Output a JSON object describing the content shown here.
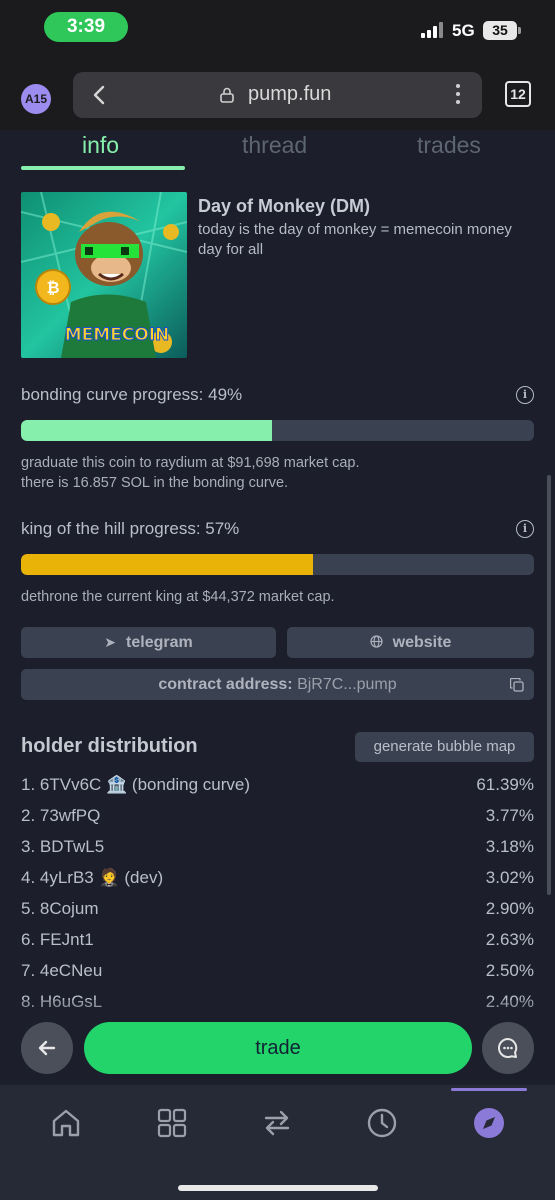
{
  "status_bar": {
    "time": "3:39",
    "network": "5G",
    "battery": "35"
  },
  "browser": {
    "profile": "A15",
    "url": "pump.fun",
    "tab_count": "12"
  },
  "tabs": [
    {
      "label": "info",
      "active": true
    },
    {
      "label": "thread",
      "active": false
    },
    {
      "label": "trades",
      "active": false
    }
  ],
  "coin": {
    "name": "Day of Monkey (DM)",
    "description": "today is the day of monkey = memecoin money day for all",
    "image_text": "MEMECOIN"
  },
  "bonding_curve": {
    "label": "bonding curve progress: 49%",
    "progress": 0.49,
    "note_line1": "graduate this coin to raydium at $91,698 market cap.",
    "note_line2": "there is 16.857 SOL in the bonding curve.",
    "color": "#86efac"
  },
  "king_of_hill": {
    "label": "king of the hill progress: 57%",
    "progress": 0.57,
    "note": "dethrone the current king at $44,372 market cap.",
    "color": "#eab308"
  },
  "links": {
    "telegram": "telegram",
    "website": "website"
  },
  "contract": {
    "label": "contract address:",
    "value": "BjR7C...pump"
  },
  "holders": {
    "title": "holder distribution",
    "bubble_button": "generate bubble map",
    "rows": [
      {
        "name": "1. 6TVv6C 🏦 (bonding curve)",
        "pct": "61.39%"
      },
      {
        "name": "2. 73wfPQ",
        "pct": "3.77%"
      },
      {
        "name": "3. BDTwL5",
        "pct": "3.18%"
      },
      {
        "name": "4. 4yLrB3 🤵 (dev)",
        "pct": "3.02%"
      },
      {
        "name": "5. 8Cojum",
        "pct": "2.90%"
      },
      {
        "name": "6. FEJnt1",
        "pct": "2.63%"
      },
      {
        "name": "7. 4eCNeu",
        "pct": "2.50%"
      },
      {
        "name": "8. H6uGsL",
        "pct": "2.40%"
      }
    ]
  },
  "actions": {
    "trade": "trade"
  },
  "bottom_nav": [
    "home-icon",
    "grid-icon",
    "swap-icon",
    "history-icon",
    "compass-icon"
  ]
}
